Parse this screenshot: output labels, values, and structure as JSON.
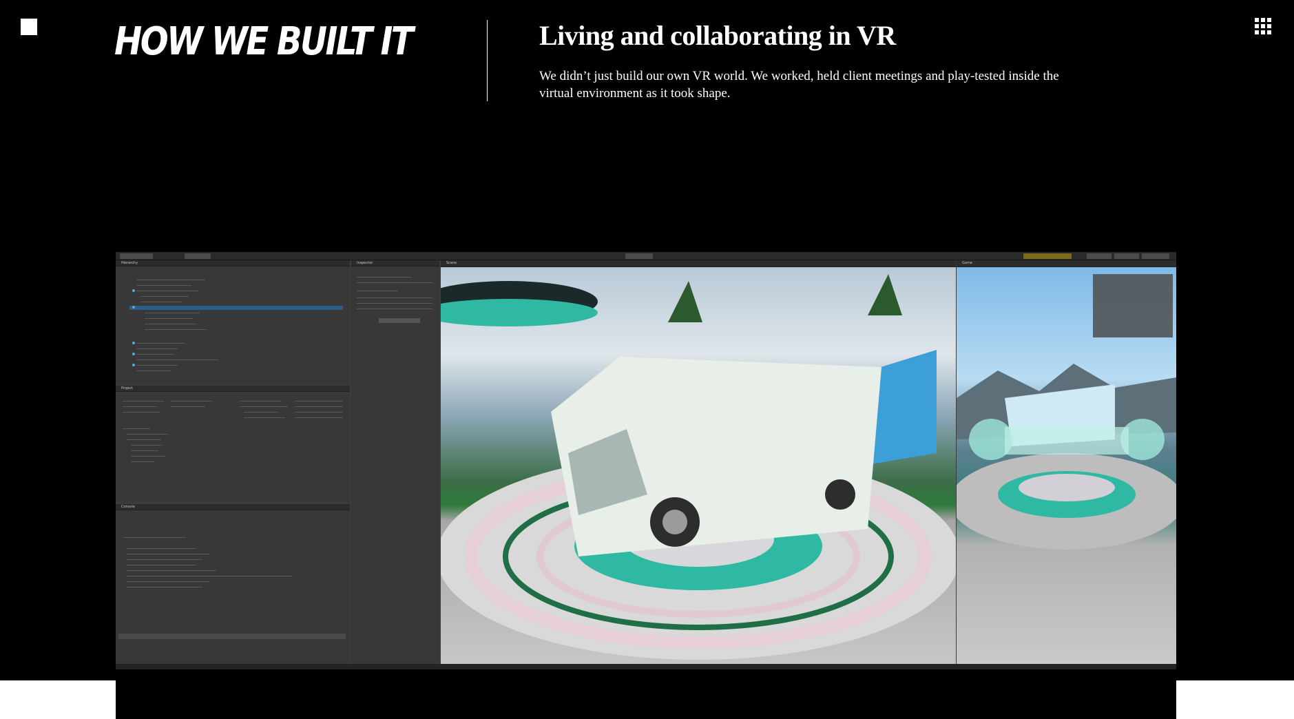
{
  "header": {
    "section_title": "HOW WE BUILT IT",
    "headline": "Living and collaborating in VR",
    "description": "We didn’t just build our own VR world. We worked, held client meetings and play-tested inside the virtual environment as it took shape."
  },
  "icons": {
    "logo": "square-logo-icon",
    "menu": "grid-menu-icon"
  },
  "screenshot": {
    "panels": {
      "hierarchy": "Hierarchy",
      "inspector": "Inspector",
      "scene": "Scene",
      "game": "Game",
      "project": "Project",
      "console": "Console"
    }
  },
  "colors": {
    "background": "#000000",
    "text": "#ffffff",
    "accent_teal": "#2fb9a2"
  }
}
